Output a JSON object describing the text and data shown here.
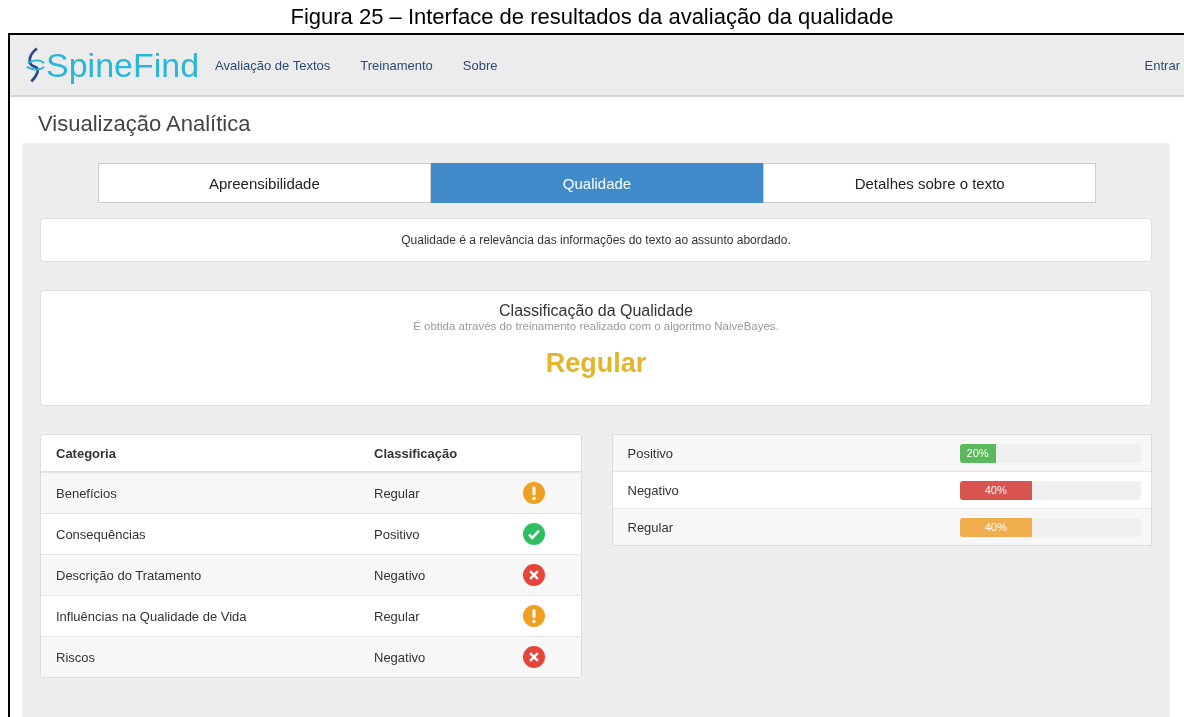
{
  "caption": "Figura 25 – Interface de resultados da avaliação da qualidade",
  "navbar": {
    "brand": "SpineFind",
    "links": [
      "Avaliação de Textos",
      "Treinamento",
      "Sobre"
    ],
    "login": "Entrar"
  },
  "page_title": "Visualização Analítica",
  "tabs": [
    {
      "label": "Apreensibilidade",
      "selected": false
    },
    {
      "label": "Qualidade",
      "selected": true
    },
    {
      "label": "Detalhes sobre o texto",
      "selected": false
    }
  ],
  "description": "Qualidade é a relevância das informações do texto ao assunto abordado.",
  "classification": {
    "title": "Classificação da Qualidade",
    "subtitle": "É obtida através do treinamento realizado com o algoritmo NaiveBayes.",
    "result": "Regular",
    "color": "#e3b52a"
  },
  "table": {
    "columns": [
      "Categoria",
      "Classificação"
    ],
    "rows": [
      {
        "category": "Benefícios",
        "classification": "Regular",
        "kind": "warning"
      },
      {
        "category": "Consequências",
        "classification": "Positivo",
        "kind": "ok"
      },
      {
        "category": "Descrição do Tratamento",
        "classification": "Negativo",
        "kind": "error"
      },
      {
        "category": "Influências na Qualidade de Vida",
        "classification": "Regular",
        "kind": "warning"
      },
      {
        "category": "Riscos",
        "classification": "Negativo",
        "kind": "error"
      }
    ]
  },
  "bars": [
    {
      "label": "Positivo",
      "level": 0.2,
      "reading": "20%",
      "color": "#5cb85c"
    },
    {
      "label": "Negativo",
      "level": 0.4,
      "reading": "40%",
      "color": "#d9534f"
    },
    {
      "label": "Regular",
      "level": 0.4,
      "reading": "40%",
      "color": "#f0ad4e"
    }
  ]
}
